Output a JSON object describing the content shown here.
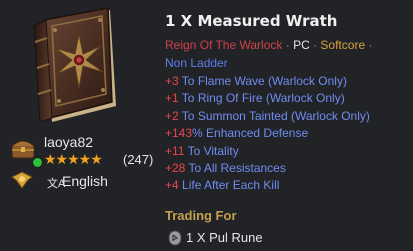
{
  "item": {
    "title": "1 X Measured Wrath",
    "set_name": "Reign Of The Warlock",
    "platform": "PC",
    "mode": "Softcore",
    "ladder": "Non Ladder",
    "separator": "·"
  },
  "stats": [
    {
      "value": "+3",
      "text": " To Flame Wave (Warlock Only)"
    },
    {
      "value": "+1",
      "text": " To Ring Of Fire (Warlock Only)"
    },
    {
      "value": "+2",
      "text": " To Summon Tainted (Warlock Only)"
    },
    {
      "value": "+143",
      "text": "% Enhanced Defense"
    },
    {
      "value": "+11",
      "text": " To Vitality"
    },
    {
      "value": "+28",
      "text": " To All Resistances"
    },
    {
      "value": "+4",
      "text": " Life After Each Kill"
    }
  ],
  "seller": {
    "name": "laoya82",
    "stars": "★★★★★",
    "rating_count": "(247)",
    "language_glyph": "文A",
    "language": "English"
  },
  "trade": {
    "heading": "Trading For",
    "item_label": "1 X Pul Rune"
  },
  "colors": {
    "background": "#222327",
    "set_name": "#d0414a",
    "mode": "#d6a33a",
    "ladder": "#5d7fe8",
    "stat_text": "#6f8df0",
    "stat_value": "#e8454c",
    "star": "#f1a21e",
    "online": "#2fbf3a",
    "trading_heading": "#c4a04e"
  },
  "icons": {
    "item": "spellbook-icon",
    "seller_avatar": "treasure-chest-icon",
    "online_status": "online-dot-icon",
    "language_badge": "gold-badge-icon",
    "language_glyph": "translate-icon",
    "trade_item": "rune-icon"
  }
}
